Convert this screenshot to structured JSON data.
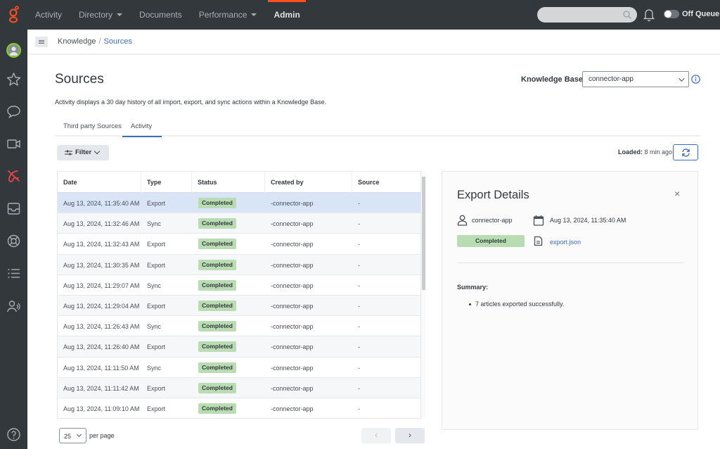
{
  "topbar": {
    "nav": [
      {
        "label": "Activity",
        "dropdown": false,
        "active": false
      },
      {
        "label": "Directory",
        "dropdown": true,
        "active": false
      },
      {
        "label": "Documents",
        "dropdown": false,
        "active": false
      },
      {
        "label": "Performance",
        "dropdown": true,
        "active": false
      },
      {
        "label": "Admin",
        "dropdown": false,
        "active": true
      }
    ],
    "search_placeholder": "",
    "queue_toggle_label": "Off Queue",
    "accent_color": "#ff4f1f"
  },
  "sidebar": {
    "items": [
      {
        "icon": "avatar"
      },
      {
        "icon": "star-icon"
      },
      {
        "icon": "chat-icon"
      },
      {
        "icon": "video-icon"
      },
      {
        "icon": "phone-icon",
        "active": true
      },
      {
        "icon": "inbox-icon"
      },
      {
        "icon": "lifebuoy-icon"
      },
      {
        "icon": "list-icon"
      },
      {
        "icon": "voice-user-icon"
      },
      {
        "icon": "help-icon"
      }
    ]
  },
  "breadcrumb": {
    "items": [
      "Knowledge",
      "Sources"
    ],
    "separator": "/"
  },
  "page": {
    "title": "Sources",
    "knowledge_base_label": "Knowledge Base",
    "knowledge_base_value": "connector-app",
    "description": "Activity displays a 30 day history of all import, export, and sync actions within a Knowledge Base.",
    "tabs": [
      {
        "label": "Third party Sources",
        "active": false
      },
      {
        "label": "Activity",
        "active": true
      }
    ],
    "filter_label": "Filter",
    "loaded_label": "Loaded:",
    "loaded_value": "8 min ago"
  },
  "table": {
    "columns": [
      "Date",
      "Type",
      "Status",
      "Created by",
      "Source"
    ],
    "rows": [
      {
        "date": "Aug 13, 2024, 11:35:40 AM",
        "type": "Export",
        "status": "Completed",
        "created_by": "-connector-app",
        "source": "-",
        "selected": true
      },
      {
        "date": "Aug 13, 2024, 11:32:46 AM",
        "type": "Sync",
        "status": "Completed",
        "created_by": "-connector-app",
        "source": "-"
      },
      {
        "date": "Aug 13, 2024, 11:32:43 AM",
        "type": "Export",
        "status": "Completed",
        "created_by": "-connector-app",
        "source": "-"
      },
      {
        "date": "Aug 13, 2024, 11:30:35 AM",
        "type": "Export",
        "status": "Completed",
        "created_by": "-connector-app",
        "source": "-"
      },
      {
        "date": "Aug 13, 2024, 11:29:07 AM",
        "type": "Sync",
        "status": "Completed",
        "created_by": "-connector-app",
        "source": "-"
      },
      {
        "date": "Aug 13, 2024, 11:29:04 AM",
        "type": "Export",
        "status": "Completed",
        "created_by": "-connector-app",
        "source": "-"
      },
      {
        "date": "Aug 13, 2024, 11:26:43 AM",
        "type": "Sync",
        "status": "Completed",
        "created_by": "-connector-app",
        "source": "-"
      },
      {
        "date": "Aug 13, 2024, 11:26:40 AM",
        "type": "Export",
        "status": "Completed",
        "created_by": "-connector-app",
        "source": "-"
      },
      {
        "date": "Aug 13, 2024, 11:11:50 AM",
        "type": "Sync",
        "status": "Completed",
        "created_by": "-connector-app",
        "source": "-"
      },
      {
        "date": "Aug 13, 2024, 11:11:42 AM",
        "type": "Export",
        "status": "Completed",
        "created_by": "-connector-app",
        "source": "-"
      },
      {
        "date": "Aug 13, 2024, 11:09:10 AM",
        "type": "Export",
        "status": "Completed",
        "created_by": "-connector-app",
        "source": "-"
      }
    ],
    "status_color": "#b9dcb3"
  },
  "pagination": {
    "per_page_value": "25",
    "per_page_label": "per page",
    "prev_label": "‹",
    "next_label": "›"
  },
  "details": {
    "title": "Export Details",
    "close_label": "×",
    "user": "connector-app",
    "date": "Aug 13, 2024, 11:35:40 AM",
    "status": "Completed",
    "file": "export.json",
    "summary_label": "Summary:",
    "summary_items": [
      "7 articles exported successfully."
    ]
  }
}
